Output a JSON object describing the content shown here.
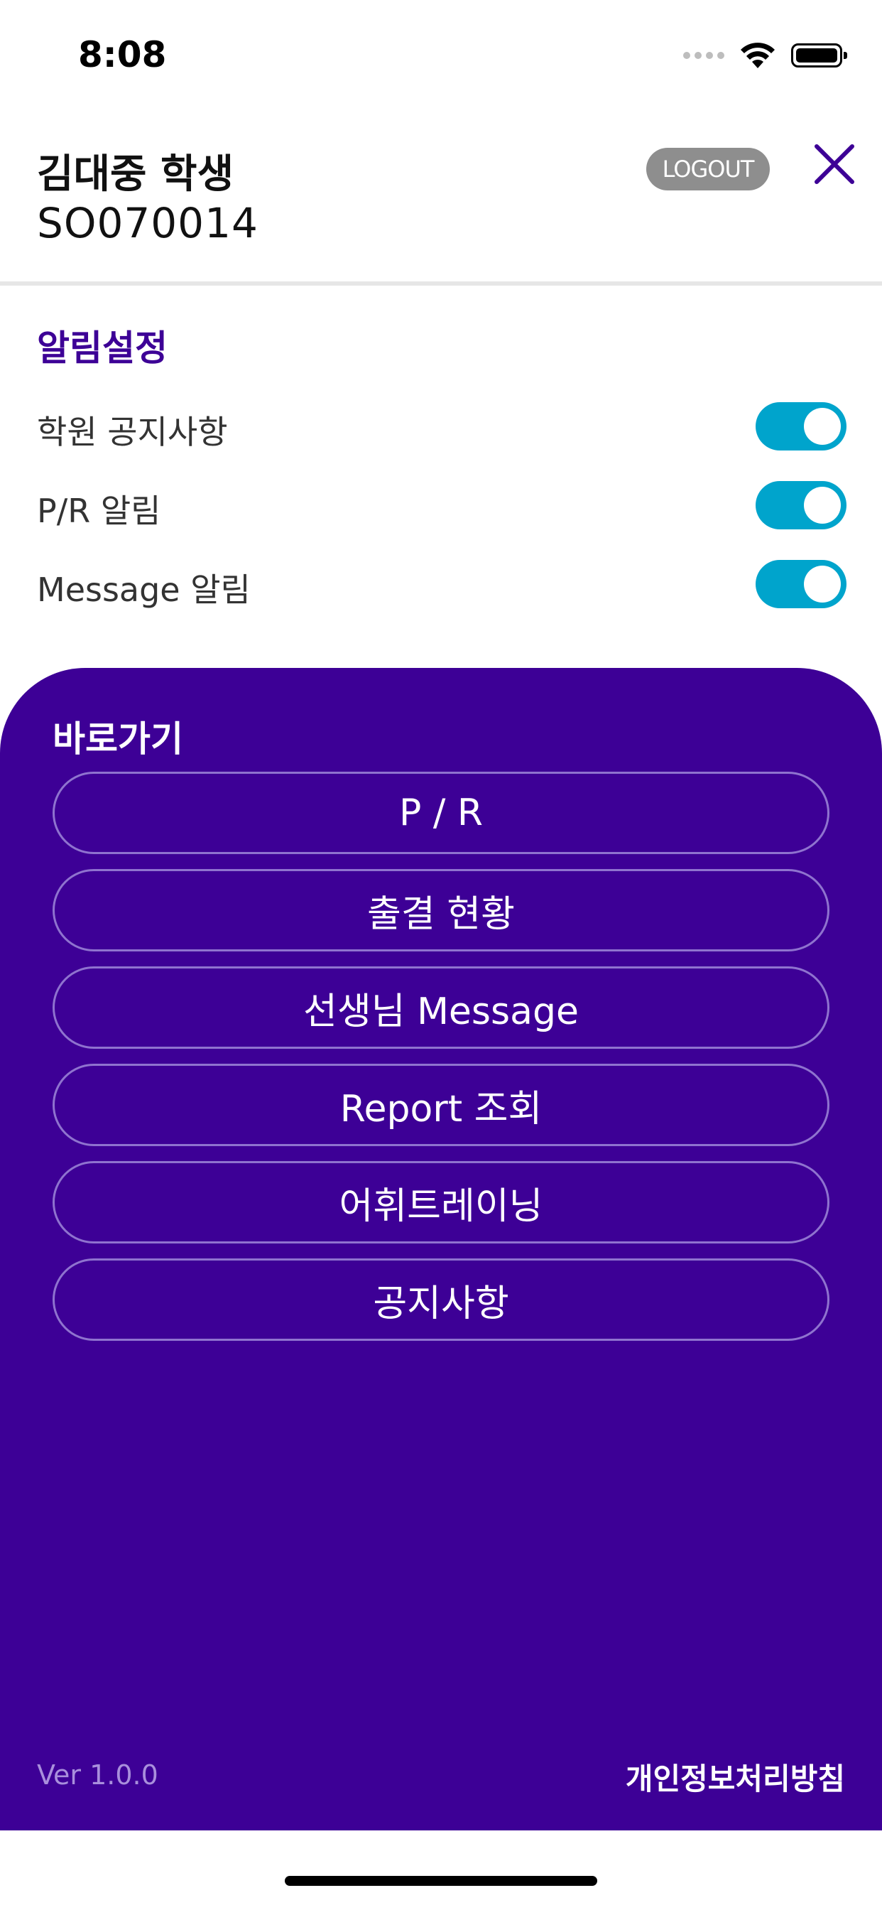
{
  "status_bar": {
    "time": "8:08"
  },
  "header": {
    "user_name": "김대중 학생",
    "user_id": "SO070014",
    "logout_label": "LOGOUT"
  },
  "notification_settings": {
    "title": "알림설정",
    "items": [
      {
        "label": "학원 공지사항",
        "enabled": true
      },
      {
        "label": "P/R 알림",
        "enabled": true
      },
      {
        "label": "Message 알림",
        "enabled": true
      }
    ]
  },
  "shortcuts": {
    "title": "바로가기",
    "items": [
      {
        "label": "P / R"
      },
      {
        "label": "출결 현황"
      },
      {
        "label": "선생님 Message"
      },
      {
        "label": "Report 조회"
      },
      {
        "label": "어휘트레이닝"
      },
      {
        "label": "공지사항"
      }
    ]
  },
  "footer": {
    "version": "Ver 1.0.0",
    "privacy_link": "개인정보처리방침"
  },
  "colors": {
    "brand_purple": "#3d0096",
    "toggle_on": "#00a4cc",
    "logout_gray": "#8e8e8e"
  }
}
